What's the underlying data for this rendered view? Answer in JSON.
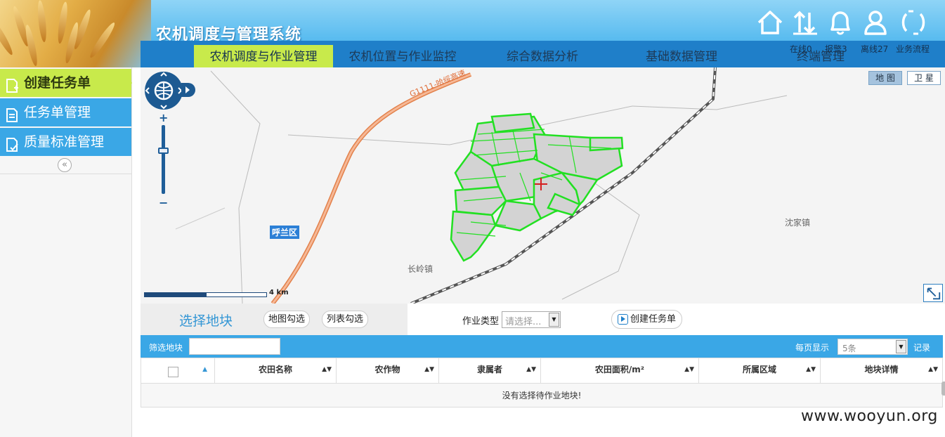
{
  "app": {
    "title": "农机调度与管理系统"
  },
  "nav": {
    "tabs": [
      {
        "label": "农机调度与作业管理",
        "active": true
      },
      {
        "label": "农机位置与作业监控",
        "active": false
      },
      {
        "label": "综合数据分析",
        "active": false
      },
      {
        "label": "基础数据管理",
        "active": false
      },
      {
        "label": "终端管理",
        "active": false
      }
    ]
  },
  "header_icons": [
    "home-icon",
    "upload-download-icon",
    "bell-icon",
    "user-icon",
    "refresh-icon"
  ],
  "status": {
    "online": "在线0",
    "alarm": "报警3",
    "offline": "离线27",
    "workflow": "业务流程"
  },
  "sidebar": {
    "items": [
      {
        "label": "创建任务单",
        "icon": "add-doc-icon",
        "active": true
      },
      {
        "label": "任务单管理",
        "icon": "list-doc-icon",
        "active": false
      },
      {
        "label": "质量标准管理",
        "icon": "check-doc-icon",
        "active": false
      }
    ],
    "collapse_label": "«"
  },
  "map": {
    "map_type_buttons": [
      {
        "label": "地 图",
        "active": true
      },
      {
        "label": "卫 星",
        "active": false
      }
    ],
    "road_label": "G1111-哈绥高速",
    "labels": {
      "district": "呼兰区",
      "town1": "长岭镇",
      "town2": "沈家镇"
    },
    "scale_text": "4 km",
    "zoom_plus": "+",
    "zoom_minus": "−"
  },
  "task_panel": {
    "select_title": "选择地块",
    "map_select_label": "地图勾选",
    "list_select_label": "列表勾选",
    "op_type_label": "作业类型",
    "op_type_placeholder": "请选择...",
    "create_label": "创建任务单",
    "filter_label": "筛选地块",
    "filter_value": "",
    "per_page_label": "每页显示",
    "per_page_value": "5条",
    "record_label": "记录"
  },
  "table": {
    "columns": [
      "农田名称",
      "农作物",
      "隶属者",
      "农田面积/m²",
      "所属区域",
      "地块详情"
    ],
    "sort_glyph": "▲▼",
    "checkbox_sort": "▲",
    "empty_text": "没有选择待作业地块!"
  },
  "watermark": "www.wooyun.org",
  "colors": {
    "primary_blue": "#3aa7e6",
    "nav_dark": "#1f7fc9",
    "active_green": "#c8ea4b",
    "field_outline": "#22e022"
  }
}
